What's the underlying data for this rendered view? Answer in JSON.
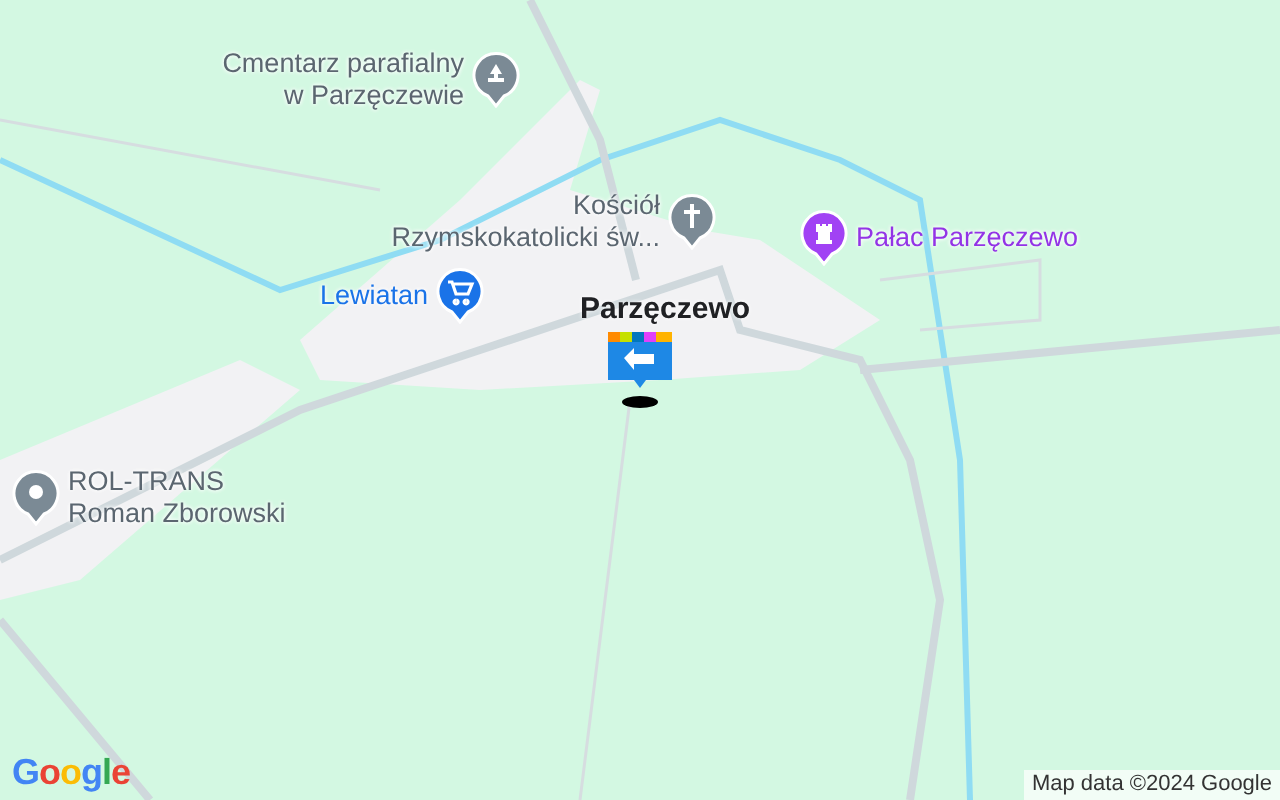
{
  "map": {
    "town_label": "Parzęczewo",
    "pois": [
      {
        "kind": "cemetery",
        "lines": [
          "Cmentarz parafialny",
          "w Parzęczewie"
        ],
        "color": "#7b8a95"
      },
      {
        "kind": "church",
        "lines": [
          "Kościół",
          "Rzymskokatolicki św..."
        ],
        "color": "#7b8a95"
      },
      {
        "kind": "shop",
        "lines": [
          "Lewiatan"
        ],
        "color": "#1a73e8"
      },
      {
        "kind": "palace",
        "lines": [
          "Pałac Parzęczewo"
        ],
        "color": "#a142f4"
      },
      {
        "kind": "place",
        "lines": [
          "ROL-TRANS",
          "Roman Zborowski"
        ],
        "color": "#7b8a95"
      }
    ],
    "logo": "Google",
    "attribution": "Map data ©2024 Google"
  }
}
